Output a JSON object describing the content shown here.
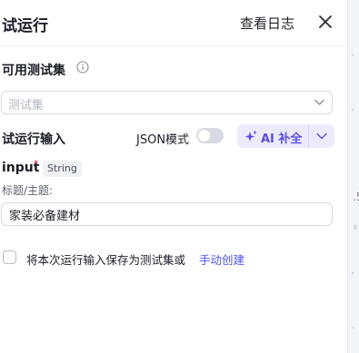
{
  "header": {
    "title": "试运行",
    "view_log_label": "查看日志",
    "close_icon": "close-icon"
  },
  "test_set": {
    "label": "可用测试集",
    "info_icon": "info-icon",
    "placeholder": "测试集",
    "chevron_icon": "chevron-down-icon"
  },
  "run_input": {
    "label": "试运行输入",
    "json_mode_label": "JSON模式",
    "json_mode_on": false,
    "ai_button_label": "AI 补全",
    "ai_icon": "sparkle-icon",
    "ai_color": "#5b4fe0"
  },
  "field": {
    "name": "input",
    "required_mark": "*",
    "type": "String",
    "description": "标题/主题:",
    "value": "家装必备建材"
  },
  "save_option": {
    "checked": false,
    "text": "将本次运行输入保存为测试集或",
    "link_label": "手动创建",
    "link_color": "#4d53e8"
  },
  "background": {
    "mark_1": ".5",
    "mark_2": "ะ"
  }
}
